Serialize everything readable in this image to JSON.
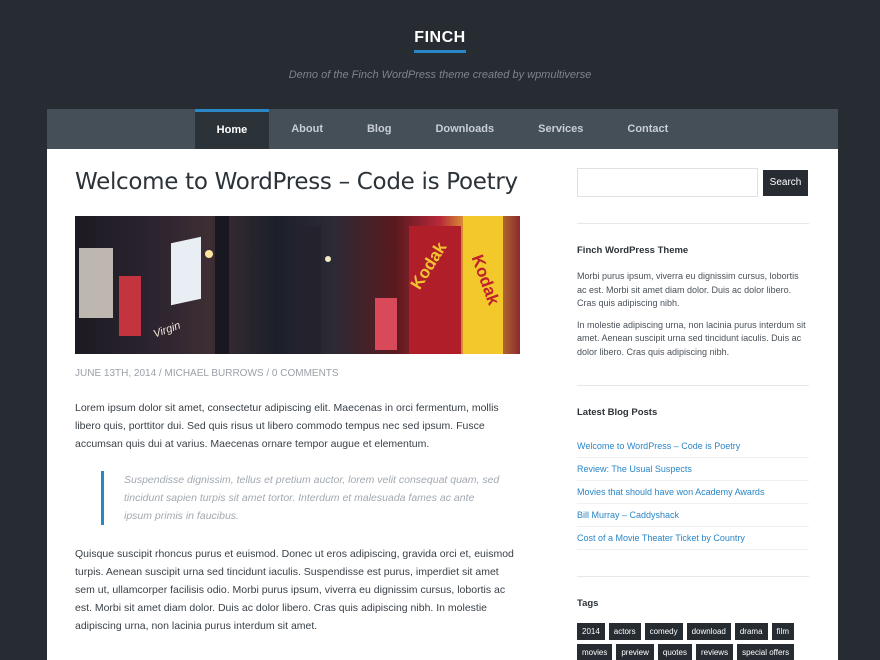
{
  "site": {
    "title": "FINCH",
    "tagline": "Demo of the Finch WordPress theme created by wpmultiverse"
  },
  "nav": {
    "items": [
      {
        "label": "Home"
      },
      {
        "label": "About"
      },
      {
        "label": "Blog"
      },
      {
        "label": "Downloads"
      },
      {
        "label": "Services"
      },
      {
        "label": "Contact"
      }
    ],
    "active": "Home"
  },
  "post": {
    "title": "Welcome to WordPress – Code is Poetry",
    "meta": "JUNE 13TH, 2014 / MICHAEL BURROWS / 0 COMMENTS",
    "paragraph1": "Lorem ipsum dolor sit amet, consectetur adipiscing elit. Maecenas in orci fermentum, mollis libero quis, porttitor dui. Sed quis risus ut libero commodo tempus nec sed ipsum. Fusce accumsan quis dui at varius. Maecenas ornare tempor augue et elementum.",
    "blockquote": "Suspendisse dignissim, tellus et pretium auctor, lorem velit consequat quam, sed tincidunt sapien turpis sit amet tortor. Interdum et malesuada fames ac ante ipsum primis in faucibus.",
    "paragraph2": "Quisque suscipit rhoncus purus et euismod. Donec ut eros adipiscing, gravida orci et, euismod turpis. Aenean suscipit urna sed tincidunt iaculis. Suspendisse est purus, imperdiet sit amet sem ut, ullamcorper facilisis odio. Morbi purus ipsum, viverra eu dignissim cursus, lobortis ac est. Morbi sit amet diam dolor. Duis ac dolor libero. Cras quis adipiscing nibh. In molestie adipiscing urna, non lacinia purus interdum sit amet.",
    "image_signs": {
      "kodak_1": "Kodak",
      "kodak_2": "Kodak",
      "virgin": "Virgin"
    }
  },
  "sidebar": {
    "search": {
      "placeholder": "",
      "button": "Search"
    },
    "about_widget": {
      "title": "Finch WordPress Theme",
      "text1": "Morbi purus ipsum, viverra eu dignissim cursus, lobortis ac est. Morbi sit amet diam dolor. Duis ac dolor libero. Cras quis adipiscing nibh.",
      "text2": "In molestie adipiscing urna, non lacinia purus interdum sit amet. Aenean suscipit urna sed tincidunt iaculis. Duis ac dolor libero. Cras quis adipiscing nibh."
    },
    "latest_posts": {
      "title": "Latest Blog Posts",
      "items": [
        "Welcome to WordPress – Code is Poetry",
        "Review: The Usual Suspects",
        "Movies that should have won Academy Awards",
        "Bill Murray – Caddyshack",
        "Cost of a Movie Theater Ticket by Country"
      ]
    },
    "tags": {
      "title": "Tags",
      "items": [
        "2014",
        "actors",
        "comedy",
        "download",
        "drama",
        "film",
        "movies",
        "preview",
        "quotes",
        "reviews",
        "special offers"
      ]
    }
  },
  "colors": {
    "background": "#262c32",
    "accent": "#2a86c6",
    "nav": "#454f57"
  }
}
